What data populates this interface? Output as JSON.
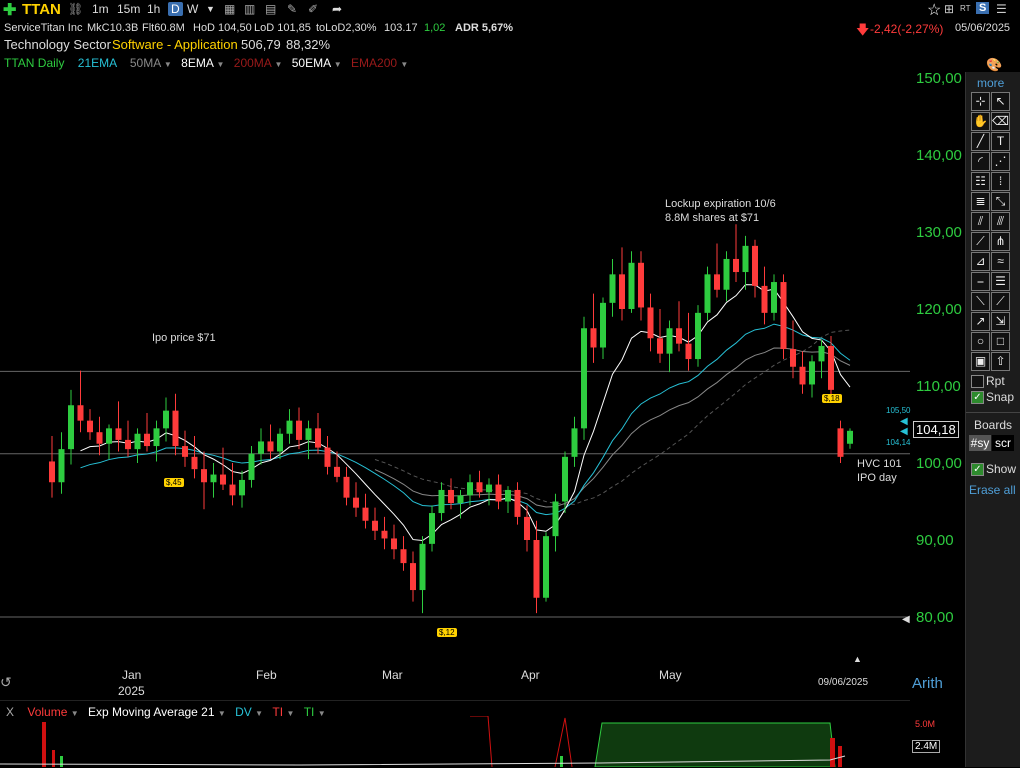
{
  "toolbar": {
    "symbol": "TTAN",
    "intervals": [
      "1m",
      "15m",
      "1h",
      "D",
      "W"
    ],
    "rt_label": "RT",
    "s_label": "S"
  },
  "info": {
    "company": "ServiceTitan Inc",
    "mkcap": "MkC10.3B",
    "float": "Flt60.8M",
    "hod": "HoD 104,50",
    "lod": "LoD 101,85",
    "tolod": "toLoD2,30%",
    "price_small": "103.17",
    "change_small": "1,02",
    "adr": "ADR 5,67%",
    "change": "-2,42(-2,27%)",
    "date": "05/06/2025",
    "sector": "Technology Sector",
    "industry": "Software - Application",
    "industry_val1": "506,79",
    "industry_val2": "88,32%"
  },
  "indicators": {
    "daily": "TTAN Daily",
    "ema21": "21EMA",
    "ma50": "50MA",
    "ema8": "8EMA",
    "ma200": "200MA",
    "ema50": "50EMA",
    "ema200": "EMA200"
  },
  "annotations": {
    "ipo_price": "Ipo price $71",
    "lockup_line1": "Lockup expiration 10/6",
    "lockup_line2": "8.8M shares at $71",
    "hvc_line1": "HVC 101",
    "hvc_line2": "IPO day"
  },
  "pills": {
    "p1": "$,45",
    "p2": "$,12",
    "p3": "$,18"
  },
  "price_axis": {
    "labels": [
      "150,00",
      "140,00",
      "130,00",
      "120,00",
      "110,00",
      "100,00",
      "90,00",
      "80,00"
    ],
    "current": "104,18",
    "upper_small": "105,50",
    "lower_small": "104,14",
    "mode": "Arith"
  },
  "time_axis": {
    "labels": [
      "Jan",
      "Feb",
      "Mar",
      "Apr",
      "May"
    ],
    "year": "2025",
    "cursor_date": "09/06/2025"
  },
  "volume_bar": {
    "close": "X",
    "volume": "Volume",
    "ema": "Exp Moving Average 21",
    "dv": "DV",
    "ti1": "TI",
    "ti2": "TI",
    "vmax": "5.0M",
    "vcur": "2.4M"
  },
  "sidebar": {
    "more": "more",
    "rpt": "Rpt",
    "snap": "Snap",
    "boards": "Boards",
    "sy": "#sy",
    "scr": "scr",
    "show": "Show",
    "erase": "Erase all"
  },
  "colors": {
    "up": "#2ecc40",
    "down": "#ff3b3b",
    "ema8": "#ffffff",
    "ema21": "#27c1d6",
    "ma50": "#888888",
    "symbol": "#ffd200"
  },
  "chart_data": {
    "type": "candlestick",
    "ylim": [
      77,
      152
    ],
    "ref_lines": [
      111.9,
      101.2,
      80
    ],
    "candles": [
      [
        100.2,
        103.5,
        95.5,
        97.5
      ],
      [
        97.5,
        104.0,
        96.0,
        101.8
      ],
      [
        101.8,
        109.5,
        99.8,
        107.5
      ],
      [
        107.5,
        112.0,
        104.0,
        105.5
      ],
      [
        105.5,
        107.0,
        103.0,
        104.0
      ],
      [
        104.0,
        106.0,
        101.0,
        102.5
      ],
      [
        102.5,
        105.0,
        100.5,
        104.5
      ],
      [
        104.5,
        108.0,
        101.5,
        103.0
      ],
      [
        103.0,
        105.5,
        100.8,
        101.8
      ],
      [
        101.8,
        104.5,
        100.0,
        103.8
      ],
      [
        103.8,
        106.5,
        101.5,
        102.2
      ],
      [
        102.2,
        105.5,
        100.2,
        104.5
      ],
      [
        104.5,
        108.5,
        102.8,
        106.8
      ],
      [
        106.8,
        109.0,
        101.0,
        102.2
      ],
      [
        102.2,
        104.2,
        99.5,
        100.8
      ],
      [
        100.8,
        103.5,
        98.0,
        99.2
      ],
      [
        99.2,
        101.5,
        94.0,
        97.5
      ],
      [
        97.5,
        100.0,
        95.5,
        98.5
      ],
      [
        98.5,
        102.0,
        96.5,
        97.2
      ],
      [
        97.2,
        100.0,
        94.5,
        95.8
      ],
      [
        95.8,
        99.0,
        94.2,
        97.8
      ],
      [
        97.8,
        102.2,
        96.8,
        101.2
      ],
      [
        101.2,
        104.5,
        99.8,
        102.8
      ],
      [
        102.8,
        105.0,
        100.5,
        101.5
      ],
      [
        101.5,
        104.5,
        100.5,
        103.8
      ],
      [
        103.8,
        107.0,
        102.5,
        105.5
      ],
      [
        105.5,
        107.2,
        101.8,
        103.0
      ],
      [
        103.0,
        105.5,
        100.5,
        104.5
      ],
      [
        104.5,
        106.5,
        101.2,
        102.0
      ],
      [
        102.0,
        103.5,
        98.5,
        99.5
      ],
      [
        99.5,
        101.5,
        97.5,
        98.2
      ],
      [
        98.2,
        99.5,
        94.5,
        95.5
      ],
      [
        95.5,
        97.5,
        93.0,
        94.2
      ],
      [
        94.2,
        96.0,
        91.5,
        92.5
      ],
      [
        92.5,
        94.2,
        90.0,
        91.2
      ],
      [
        91.2,
        93.0,
        88.8,
        90.2
      ],
      [
        90.2,
        92.0,
        87.5,
        88.8
      ],
      [
        88.8,
        90.5,
        86.0,
        87.0
      ],
      [
        87.0,
        88.5,
        82.0,
        83.5
      ],
      [
        83.5,
        90.5,
        80.5,
        89.5
      ],
      [
        89.5,
        94.5,
        88.5,
        93.5
      ],
      [
        93.5,
        97.5,
        92.5,
        96.5
      ],
      [
        96.5,
        98.0,
        94.0,
        94.8
      ],
      [
        94.8,
        96.5,
        92.8,
        95.8
      ],
      [
        95.8,
        98.5,
        94.5,
        97.5
      ],
      [
        97.5,
        99.0,
        95.5,
        96.2
      ],
      [
        96.2,
        98.0,
        94.5,
        97.2
      ],
      [
        97.2,
        98.5,
        94.0,
        95.0
      ],
      [
        95.0,
        97.0,
        93.5,
        96.5
      ],
      [
        96.5,
        97.5,
        92.0,
        93.0
      ],
      [
        93.0,
        94.5,
        88.5,
        90.0
      ],
      [
        90.0,
        92.5,
        80.5,
        82.5
      ],
      [
        82.5,
        91.0,
        82.0,
        90.5
      ],
      [
        90.5,
        96.0,
        88.5,
        95.0
      ],
      [
        95.0,
        101.5,
        93.5,
        100.8
      ],
      [
        100.8,
        106.0,
        99.5,
        104.5
      ],
      [
        104.5,
        119.0,
        103.0,
        117.5
      ],
      [
        117.5,
        122.0,
        113.0,
        115.0
      ],
      [
        115.0,
        121.5,
        113.5,
        120.8
      ],
      [
        120.8,
        126.5,
        119.0,
        124.5
      ],
      [
        124.5,
        128.0,
        118.5,
        120.0
      ],
      [
        120.0,
        127.5,
        119.5,
        126.0
      ],
      [
        126.0,
        127.5,
        118.5,
        120.2
      ],
      [
        120.2,
        122.0,
        114.5,
        116.2
      ],
      [
        116.2,
        120.0,
        113.0,
        114.2
      ],
      [
        114.2,
        118.5,
        111.8,
        117.5
      ],
      [
        117.5,
        121.0,
        114.5,
        115.5
      ],
      [
        115.5,
        119.5,
        112.0,
        113.5
      ],
      [
        113.5,
        120.5,
        112.5,
        119.5
      ],
      [
        119.5,
        125.5,
        118.5,
        124.5
      ],
      [
        124.5,
        128.5,
        121.5,
        122.5
      ],
      [
        122.5,
        127.5,
        121.0,
        126.5
      ],
      [
        126.5,
        131.0,
        123.5,
        124.8
      ],
      [
        124.8,
        129.5,
        122.5,
        128.2
      ],
      [
        128.2,
        129.0,
        121.5,
        123.0
      ],
      [
        123.0,
        125.5,
        118.0,
        119.5
      ],
      [
        119.5,
        124.5,
        118.5,
        123.5
      ],
      [
        123.5,
        124.5,
        113.5,
        114.8
      ],
      [
        114.8,
        118.5,
        111.0,
        112.5
      ],
      [
        112.5,
        114.5,
        109.0,
        110.2
      ],
      [
        110.2,
        114.0,
        108.5,
        113.2
      ],
      [
        113.2,
        116.0,
        111.0,
        115.2
      ],
      [
        115.2,
        116.5,
        108.0,
        109.5
      ],
      [
        104.5,
        105.5,
        100.0,
        100.8
      ],
      [
        102.5,
        104.5,
        101.85,
        104.18
      ]
    ]
  }
}
